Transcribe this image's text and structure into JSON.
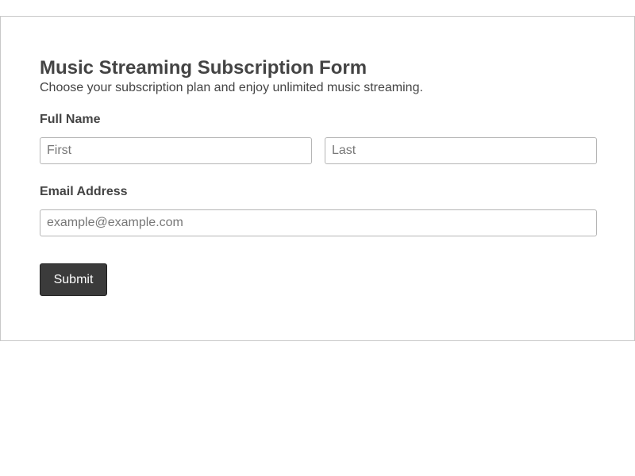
{
  "form": {
    "title": "Music Streaming Subscription Form",
    "subtitle": "Choose your subscription plan and enjoy unlimited music streaming.",
    "full_name": {
      "label": "Full Name",
      "first_placeholder": "First",
      "first_value": "",
      "last_placeholder": "Last",
      "last_value": ""
    },
    "email": {
      "label": "Email Address",
      "placeholder": "example@example.com",
      "value": ""
    },
    "submit_label": "Submit"
  }
}
